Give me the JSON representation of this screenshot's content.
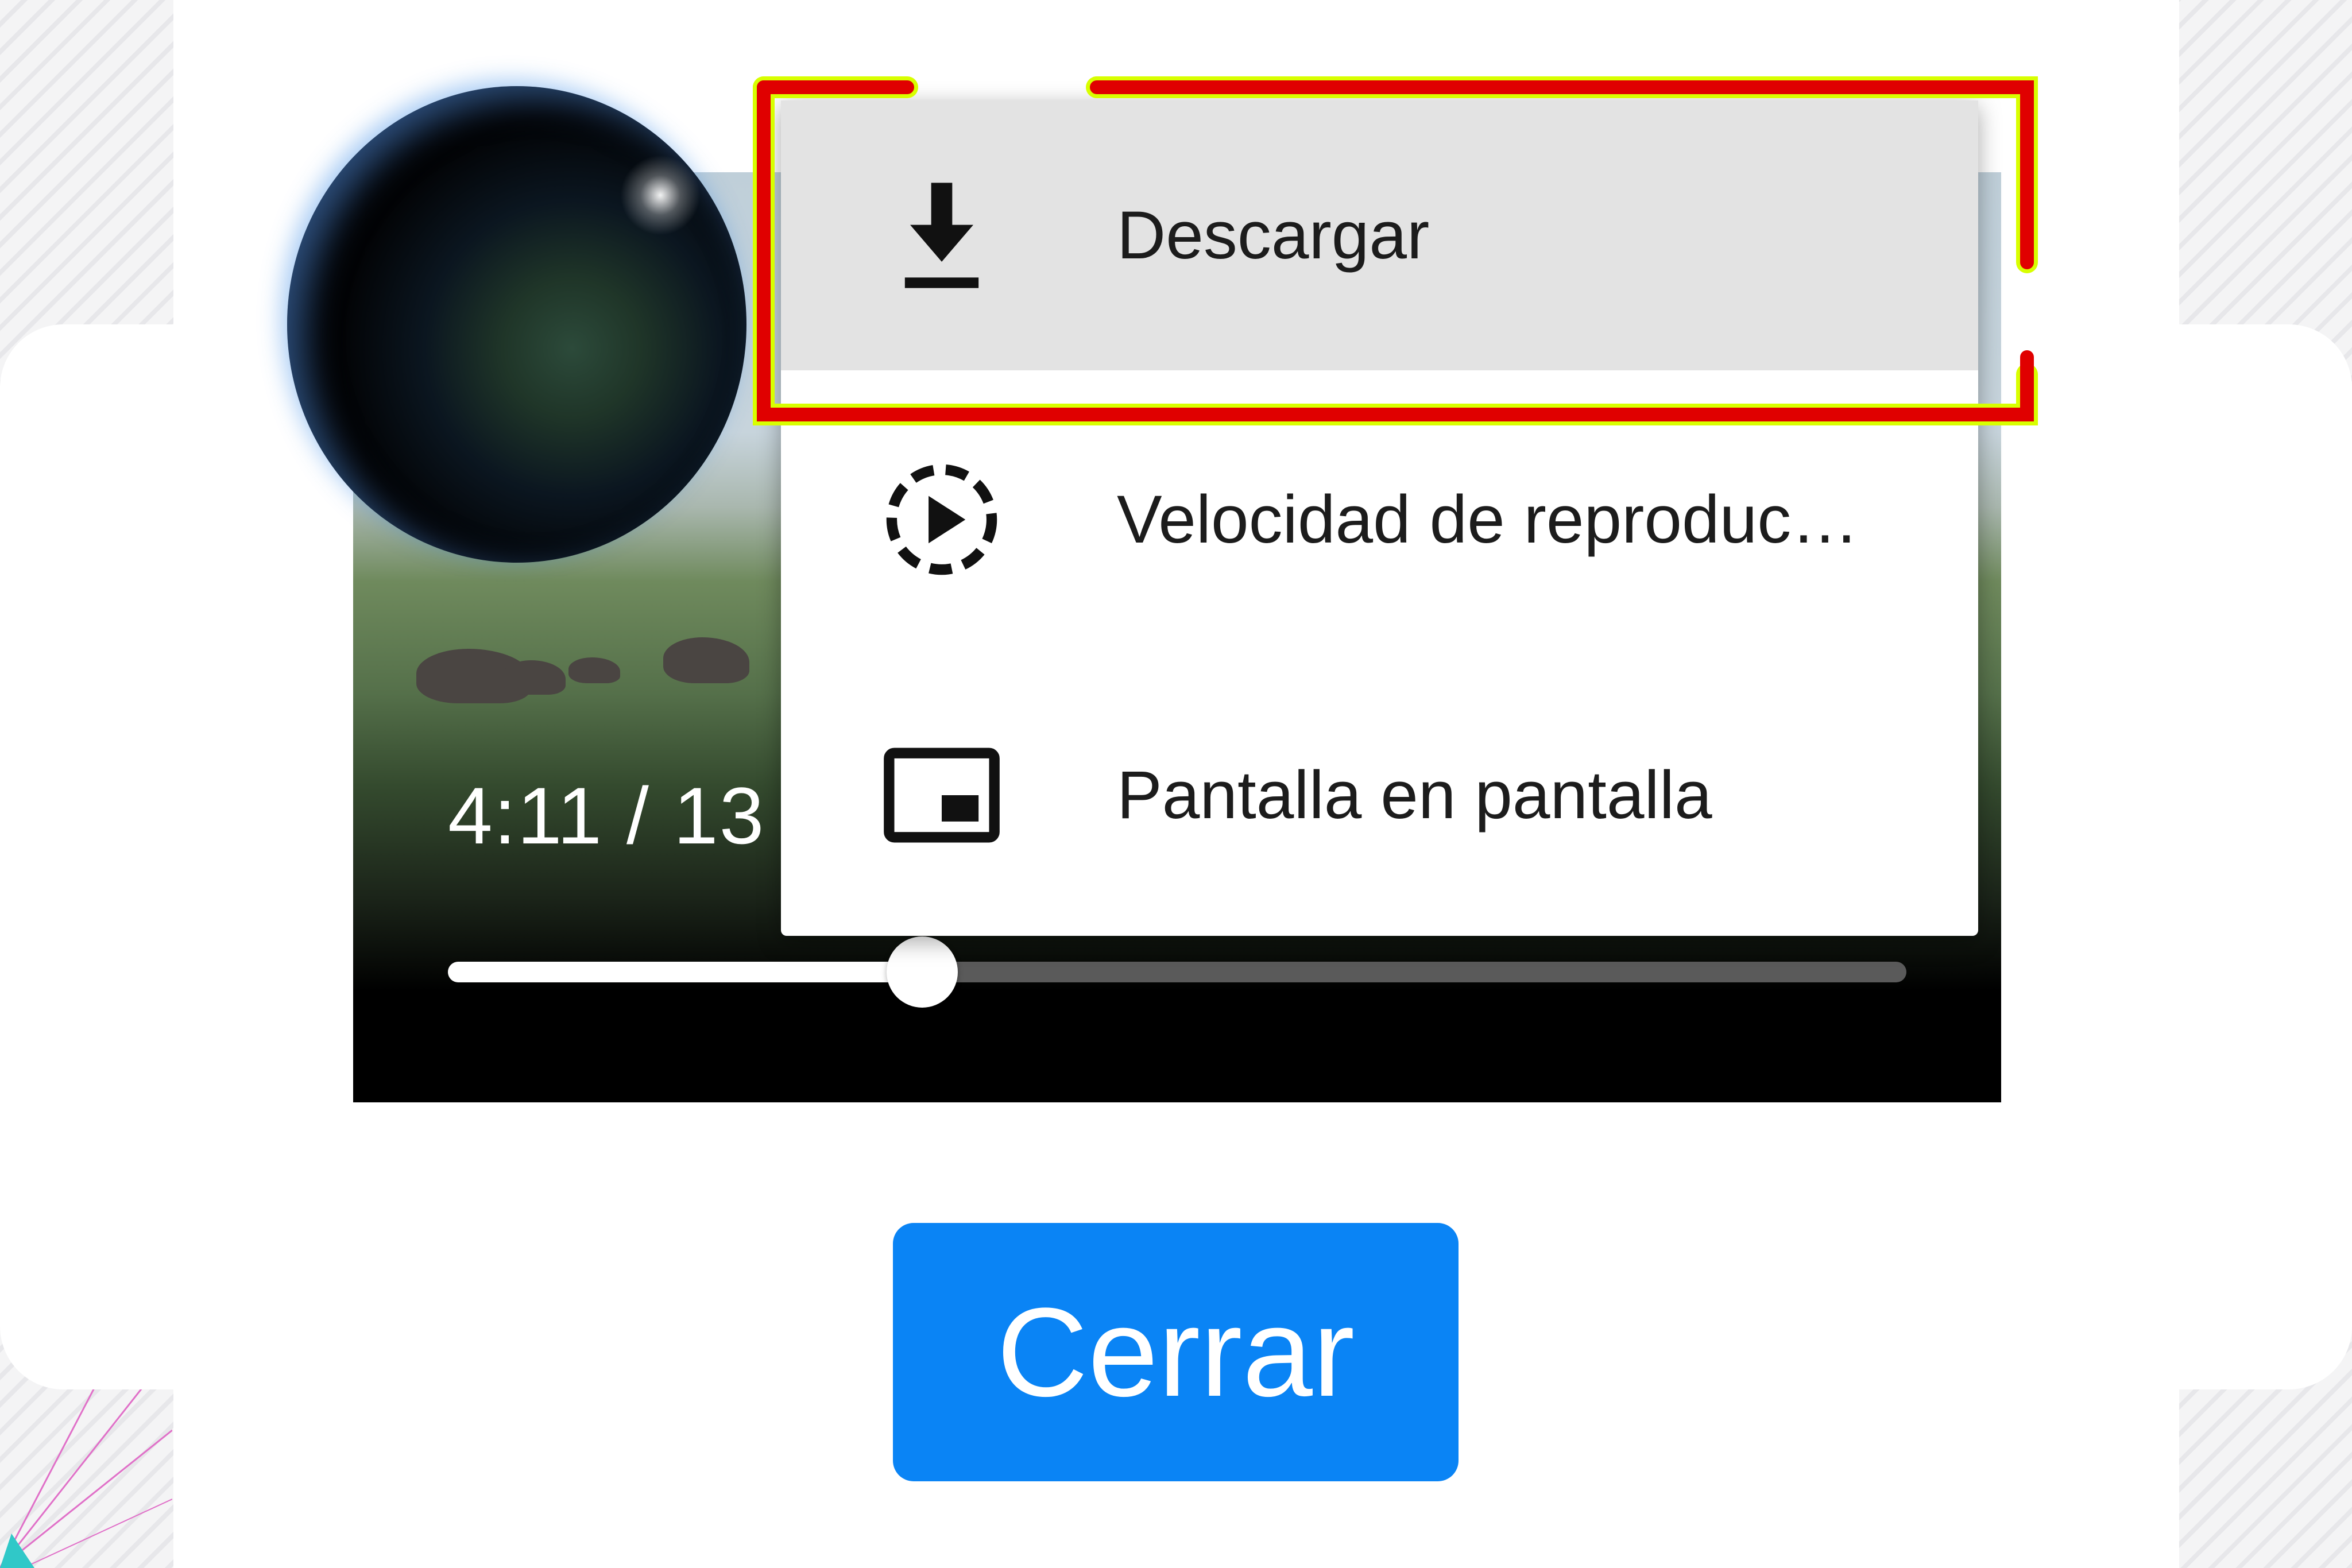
{
  "video": {
    "time_display": "4:11 / 13",
    "progress_fraction": 0.325
  },
  "menu": {
    "items": [
      {
        "label": "Descargar",
        "icon": "download-icon"
      },
      {
        "label": "Velocidad de reproduc…",
        "icon": "playback-speed-icon"
      },
      {
        "label": "Pantalla en pantalla",
        "icon": "picture-in-picture-icon"
      }
    ]
  },
  "dialog": {
    "close_label": "Cerrar"
  },
  "colors": {
    "accent_button": "#0a84f5",
    "annotation_red": "#e00000",
    "annotation_yellow": "#d8ff00",
    "menu_highlight": "#e3e3e3"
  }
}
